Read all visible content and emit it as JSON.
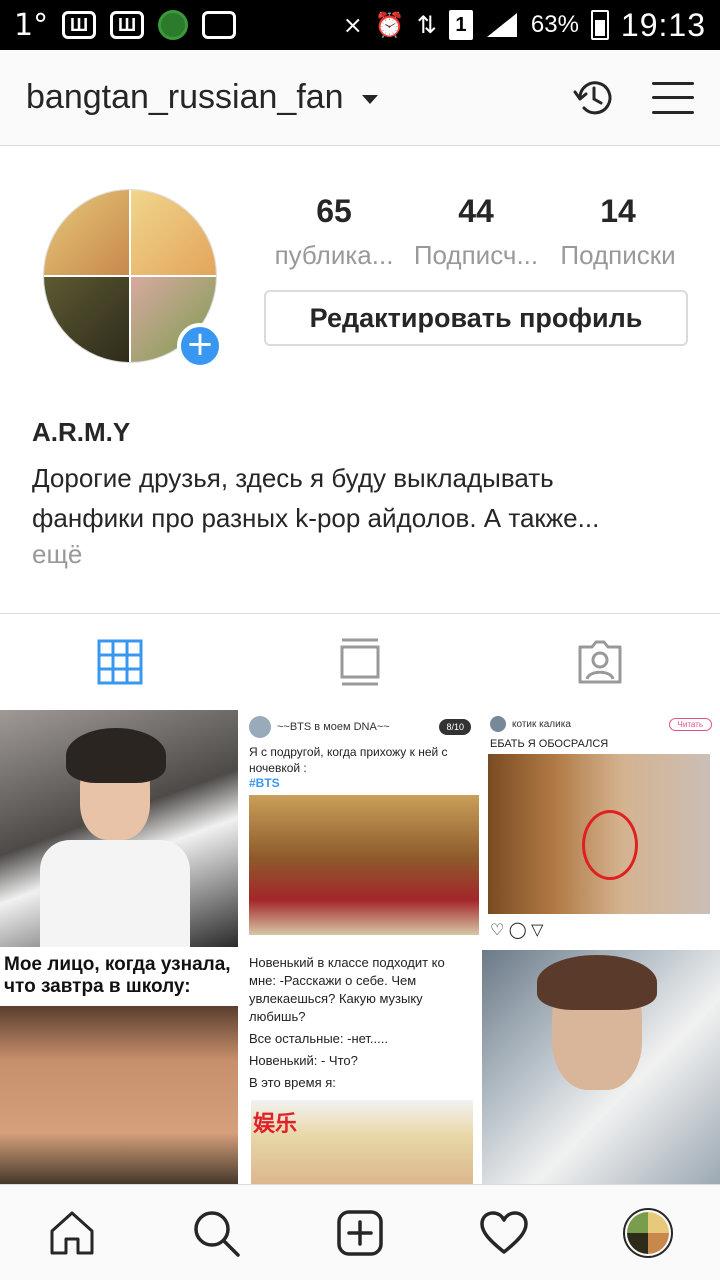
{
  "status_bar": {
    "temperature": "1°",
    "battery": "63%",
    "sim": "1",
    "time": "19:13"
  },
  "header": {
    "username": "bangtan_russian_fan"
  },
  "profile": {
    "stats": [
      {
        "value": "65",
        "label": "публика..."
      },
      {
        "value": "44",
        "label": "Подписч..."
      },
      {
        "value": "14",
        "label": "Подписки"
      }
    ],
    "edit_button": "Редактировать профиль",
    "name": "A.R.M.Y",
    "bio": "Дорогие друзья, здесь я буду выкладывать фанфики про разных k-pop айдолов. А также...",
    "more": "ещё"
  },
  "tabs": [
    {
      "icon": "grid-icon",
      "active": true
    },
    {
      "icon": "feed-icon",
      "active": false
    },
    {
      "icon": "tagged-icon",
      "active": false
    }
  ],
  "posts": {
    "post2": {
      "account": "~~BTS в моем DNA~~",
      "badge": "8/10",
      "text": "Я с подругой, когда прихожу к ней с ночевкой :",
      "hashtag": "#BTS"
    },
    "post3": {
      "account": "котик калика",
      "follow": "Читать",
      "text": "ЕБАТЬ Я ОБОСРАЛСЯ"
    },
    "post4": {
      "caption": "Мое лицо, когда узнала, что завтра в школу:"
    },
    "post5": {
      "lines": [
        "Новенький в классе подходит ко мне: -Расскажи о себе. Чем увлекаешься? Какую музыку любишь?",
        "Все остальные: -нет.....",
        "Новенький: - Что?",
        "В это время я:"
      ],
      "overlay": "娱乐"
    }
  },
  "bottom_nav": [
    {
      "icon": "home-icon"
    },
    {
      "icon": "search-icon"
    },
    {
      "icon": "add-post-icon"
    },
    {
      "icon": "heart-icon"
    },
    {
      "icon": "profile-avatar"
    }
  ],
  "colors": {
    "accent": "#3897f0",
    "text": "#262626",
    "muted": "#999999",
    "border": "#dbdbdb"
  }
}
